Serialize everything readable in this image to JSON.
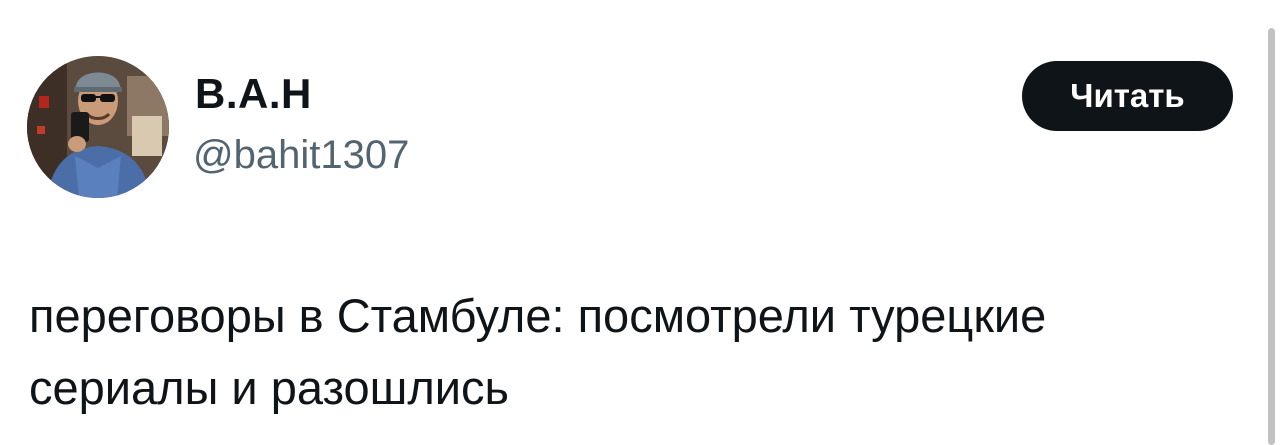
{
  "author": {
    "display_name": "В.А.Н",
    "handle": "@bahit1307",
    "avatar_icon": "profile-photo-avatar"
  },
  "actions": {
    "read_label": "Читать"
  },
  "tweet": {
    "text": "переговоры в Стамбуле: посмотрели турецкие\nсериалы и разошлись"
  },
  "colors": {
    "primary_text": "#0f1419",
    "secondary_text": "#536471",
    "button_bg": "#0f1419",
    "button_text": "#ffffff",
    "background": "#ffffff"
  }
}
